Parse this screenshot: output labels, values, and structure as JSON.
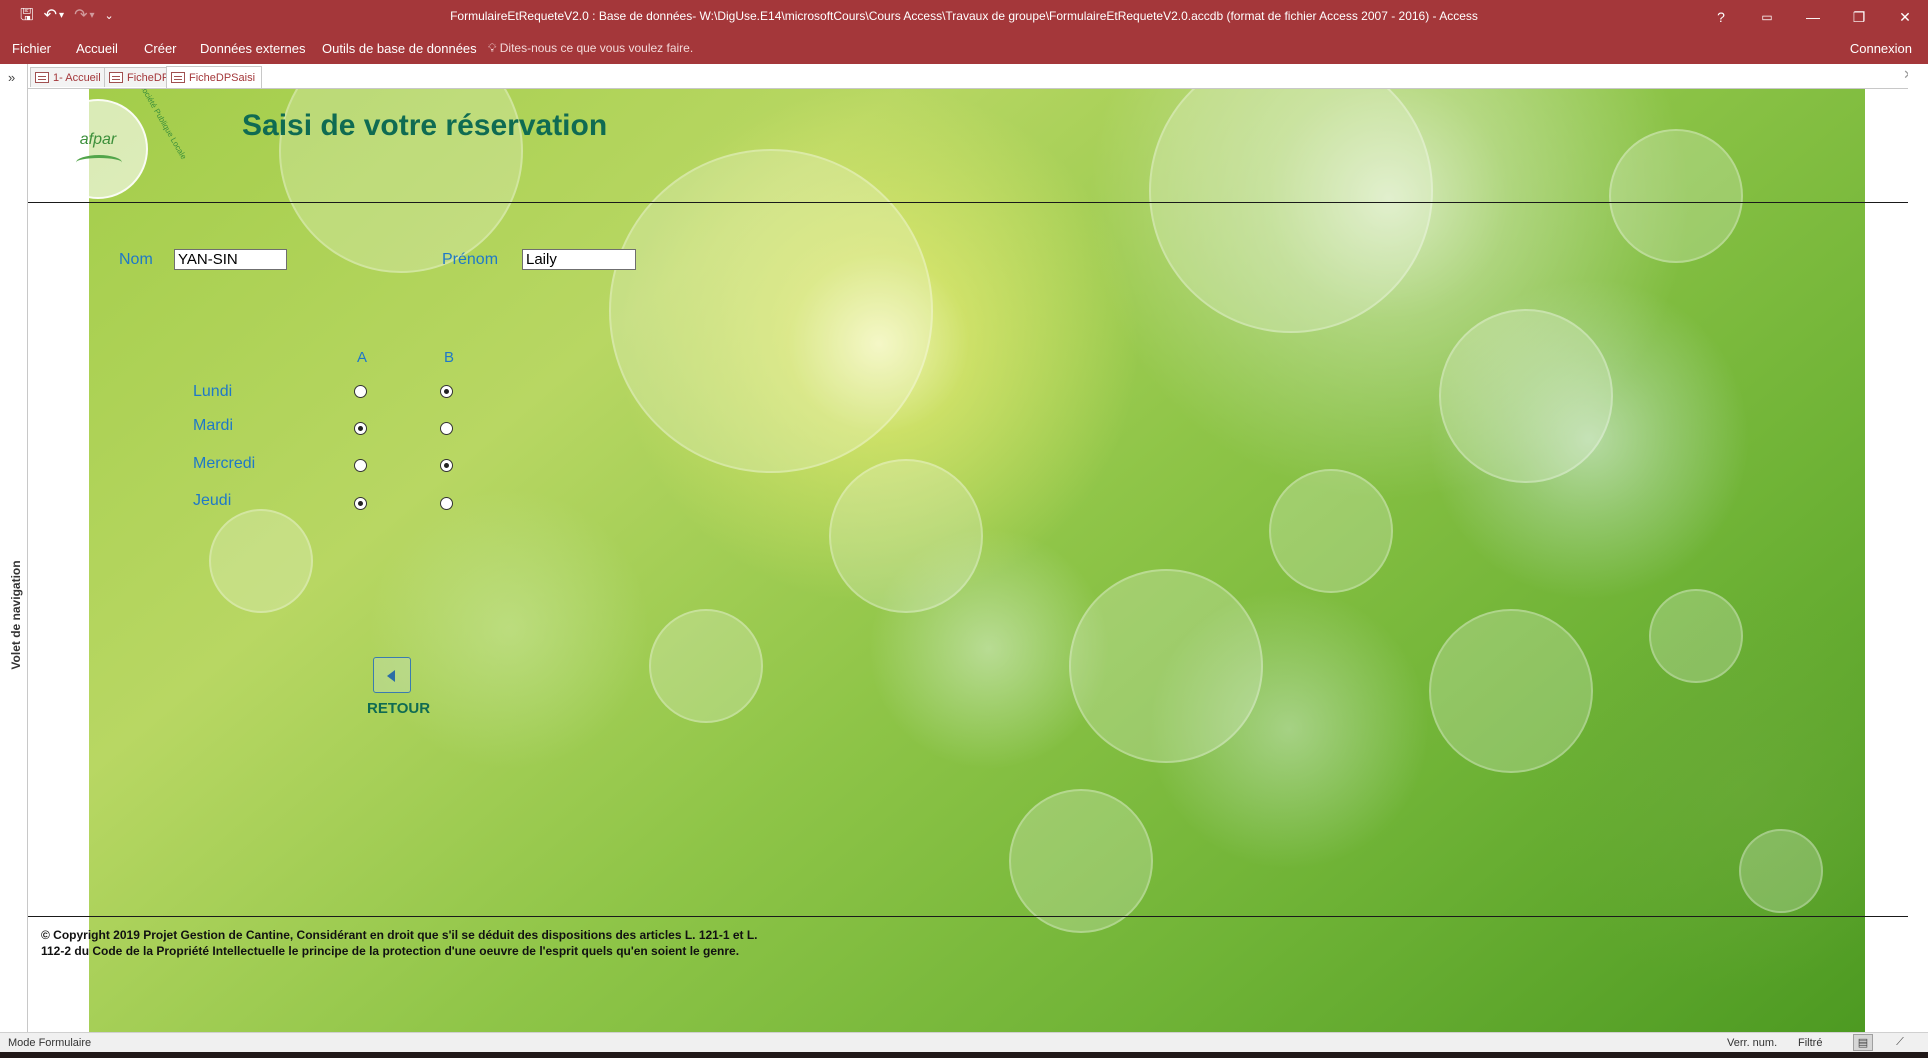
{
  "window": {
    "title": "FormulaireEtRequeteV2.0 : Base de données- W:\\DigUse.E14\\microsoftCours\\Cours Access\\Travaux de groupe\\FormulaireEtRequeteV2.0.accdb (format de fichier Access 2007 - 2016) - Access",
    "help": "?",
    "minimize": "—",
    "restore": "❐",
    "close": "✕"
  },
  "qat": {
    "save": "🖫",
    "undo": "↶",
    "undo_menu": "▾",
    "redo": "↷",
    "redo_menu": "▾",
    "customize": "⌄"
  },
  "ribbon": {
    "tabs": [
      "Fichier",
      "Accueil",
      "Créer",
      "Données externes",
      "Outils de base de données"
    ],
    "tell_me": "Dites-nous ce que vous voulez faire.",
    "tell_me_icon": "lightbulb-icon",
    "account": "Connexion"
  },
  "nav_pane": {
    "label": "Volet de navigation",
    "toggle": "»"
  },
  "doc_tabs": [
    {
      "label": "1- Accueil",
      "active": false
    },
    {
      "label": "FicheDP",
      "active": false
    },
    {
      "label": "FicheDPSaisi",
      "active": true
    }
  ],
  "doc_close": "✕",
  "form": {
    "logo_text": "afpar",
    "logo_arc": "Société Publique Locale",
    "title": "Saisi de votre réservation",
    "nom_label": "Nom",
    "nom_value": "YAN-SIN",
    "prenom_label": "Prénom",
    "prenom_value": "Laily",
    "col_a": "A",
    "col_b": "B",
    "days": [
      {
        "name": "Lundi",
        "choice": "B"
      },
      {
        "name": "Mardi",
        "choice": "A"
      },
      {
        "name": "Mercredi",
        "choice": "B"
      },
      {
        "name": "Jeudi",
        "choice": "A"
      }
    ],
    "back_label": "RETOUR",
    "copyright": "© Copyright 2019 Projet Gestion de Cantine, Considérant en droit que s'il se déduit des dispositions des articles L. 121-1 et L. 112-2 du Code de la Propriété Intellectuelle le principe de la protection d'une oeuvre de l'esprit quels qu'en soient le genre."
  },
  "status": {
    "mode": "Mode Formulaire",
    "num_lock": "Verr. num.",
    "filter": "Filtré"
  },
  "colors": {
    "accent": "#a4373a",
    "title_green": "#0f6b52",
    "label_blue": "#1e78c8"
  }
}
